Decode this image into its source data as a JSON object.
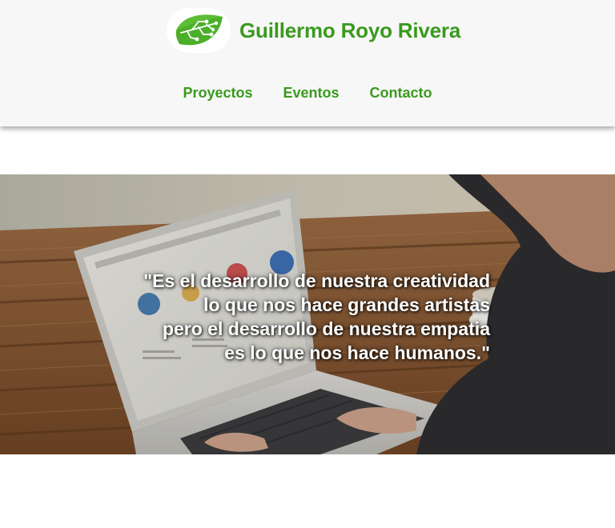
{
  "header": {
    "site_title": "Guillermo Royo Rivera",
    "logo_icon": "leaf-circuit-icon",
    "brand_color": "#3a9a1e"
  },
  "nav": {
    "items": [
      {
        "label": "Proyectos"
      },
      {
        "label": "Eventos"
      },
      {
        "label": "Contacto"
      }
    ]
  },
  "hero": {
    "image": "person-using-laptop-on-wooden-table",
    "quote_lines": [
      "\"Es el desarrollo de nuestra creatividad",
      "lo que nos hace grandes artistas",
      "pero el desarrollo de nuestra empatia",
      "es lo que nos hace humanos.\""
    ]
  }
}
